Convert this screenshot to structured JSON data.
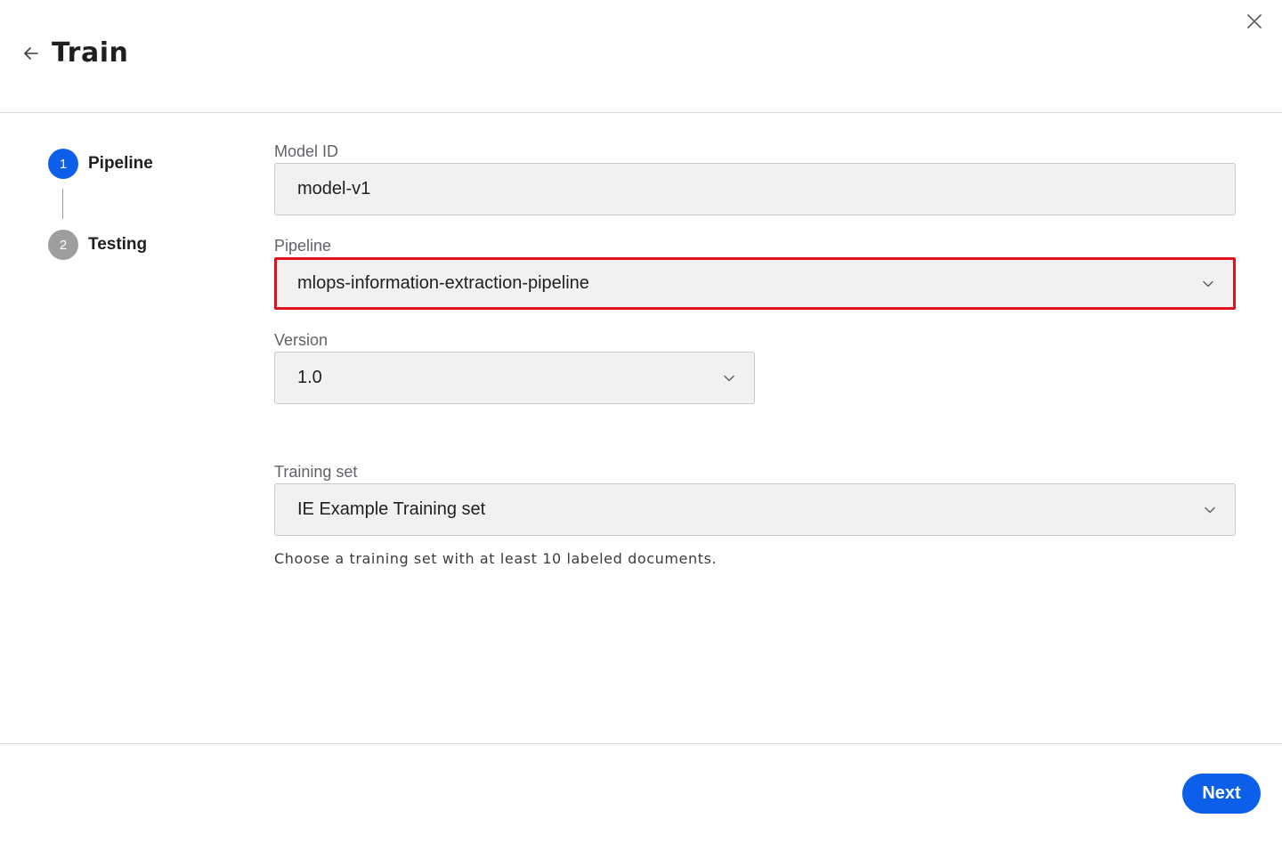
{
  "header": {
    "title": "Train",
    "back_icon": "arrow-left-icon",
    "close_icon": "close-icon"
  },
  "stepper": {
    "steps": [
      {
        "number": "1",
        "label": "Pipeline",
        "state": "active",
        "color": "#0b5fe8"
      },
      {
        "number": "2",
        "label": "Testing",
        "state": "inactive",
        "color": "#9e9e9e"
      }
    ]
  },
  "form": {
    "model_id": {
      "label": "Model ID",
      "value": "model-v1"
    },
    "pipeline": {
      "label": "Pipeline",
      "value": "mlops-information-extraction-pipeline",
      "highlighted": true,
      "highlight_color": "#e0121e"
    },
    "version": {
      "label": "Version",
      "value": "1.0"
    },
    "training_set": {
      "label": "Training set",
      "value": "IE Example Training set",
      "helper": "Choose a training set with at least 10 labeled documents."
    }
  },
  "footer": {
    "next_label": "Next",
    "accent": "#0b5fe8"
  }
}
